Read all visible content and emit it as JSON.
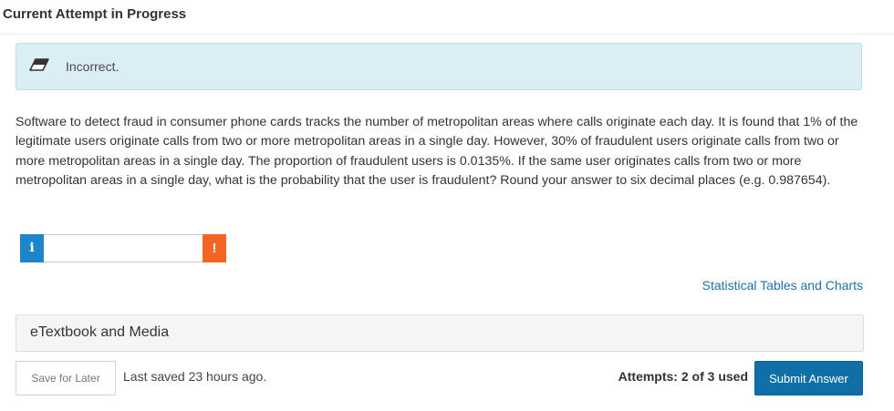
{
  "header": {
    "title": "Current Attempt in Progress"
  },
  "feedback": {
    "icon": "eraser-icon",
    "text": "Incorrect.",
    "background_color": "#dbeef6"
  },
  "question": {
    "text": "Software to detect fraud in consumer phone cards tracks the number of metropolitan areas where calls originate each day. It is found that 1% of the legitimate users originate calls from two or more metropolitan areas in a single day. However, 30% of fraudulent users originate calls from two or more metropolitan areas in a single day. The proportion of fraudulent users is 0.0135%. If the same user originates calls from two or more metropolitan areas in a single day, what is the probability that the user is fraudulent? Round your answer to six decimal places (e.g. 0.987654)."
  },
  "answer": {
    "info_badge": "i",
    "value": "",
    "placeholder": "",
    "warning_badge": "!",
    "info_color": "#1c86c8",
    "warning_color": "#f26522"
  },
  "links": {
    "tables_label": "Statistical Tables and Charts"
  },
  "etextbook": {
    "label": "eTextbook and Media"
  },
  "footer": {
    "save_label": "Save for Later",
    "last_saved": "Last saved 23 hours ago.",
    "attempts": "Attempts: 2 of 3 used",
    "submit_label": "Submit Answer",
    "submit_color": "#0f6fa6"
  }
}
